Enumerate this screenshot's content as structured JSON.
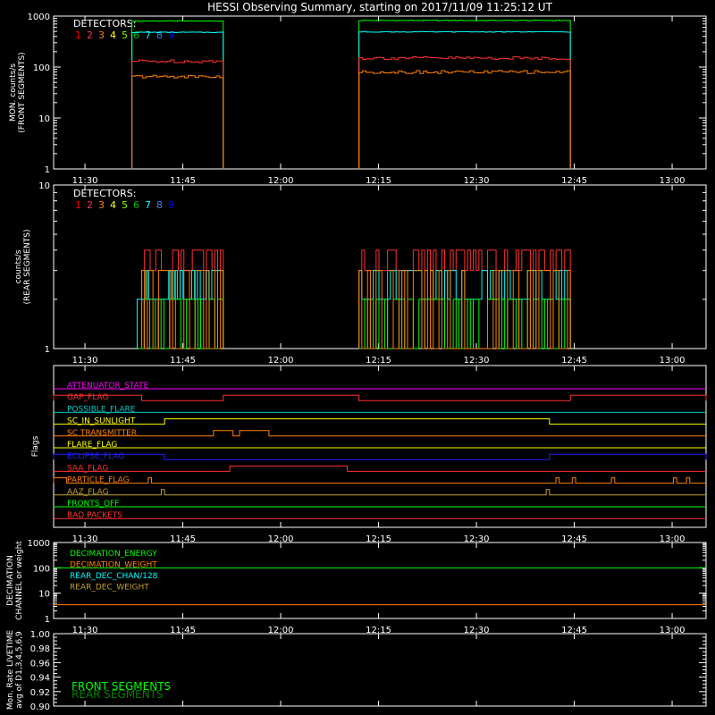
{
  "title": "HESSI Observing Summary, starting on 2017/11/09 11:25:12 UT",
  "time_axis": {
    "start_min": 0,
    "end_min": 100,
    "tick_labels": [
      "11:30",
      "11:45",
      "12:00",
      "12:15",
      "12:30",
      "12:45",
      "13:00"
    ],
    "tick_minutes": [
      4.8,
      19.8,
      34.8,
      49.8,
      64.8,
      79.8,
      94.8
    ]
  },
  "colors": {
    "frame": "#ffffff",
    "det": [
      "#ff3030",
      "#ff3030",
      "#ff8000",
      "#ffff00",
      "#80c000",
      "#00ff00",
      "#00ffff",
      "#0090ff",
      "#0000ff"
    ],
    "det_labels_colors": [
      "#ff0000",
      "#ff3060",
      "#ff8000",
      "#ffff00",
      "#80ff00",
      "#00c000",
      "#00ffff",
      "#4080ff",
      "#0000ff"
    ]
  },
  "chart_data": [
    {
      "id": "front",
      "type": "line",
      "ylabel": "MON. counts/s\n(FRONT SEGMENTS)",
      "yscale": "log",
      "ylim": [
        1,
        1000
      ],
      "ytick_labels": [
        "1",
        "10",
        "100",
        "1000"
      ],
      "legend_title": "DETECTORS:",
      "legend_numbers": [
        "1",
        "2",
        "3",
        "4",
        "5",
        "6",
        "7",
        "8",
        "9"
      ],
      "series": [
        {
          "color": "#00ff00",
          "segments": [
            [
              12.0,
              26.0,
              800
            ],
            [
              46.8,
              79.2,
              820
            ]
          ]
        },
        {
          "color": "#00ffff",
          "segments": [
            [
              12.0,
              26.0,
              480
            ],
            [
              46.8,
              79.2,
              490
            ]
          ]
        },
        {
          "color": "#ff3030",
          "segments": [
            [
              12.0,
              26.0,
              130
            ],
            [
              46.8,
              79.2,
              150
            ]
          ]
        },
        {
          "color": "#ff8000",
          "segments": [
            [
              12.0,
              26.0,
              65
            ],
            [
              46.8,
              79.2,
              80
            ]
          ]
        }
      ]
    },
    {
      "id": "rear",
      "type": "line",
      "ylabel": "counts/s\n(REAR SEGMENTS)",
      "yscale": "log",
      "ylim": [
        1,
        10
      ],
      "ytick_labels": [
        "1",
        "10"
      ],
      "legend_title": "DETECTORS:",
      "legend_numbers": [
        "1",
        "2",
        "3",
        "4",
        "5",
        "6",
        "7",
        "8",
        "9"
      ],
      "series": [
        {
          "color": "#ff3030",
          "levels": [
            3,
            4
          ],
          "segments": [
            [
              13.5,
              26.0
            ],
            [
              46.8,
              79.2
            ]
          ]
        },
        {
          "color": "#00ffff",
          "levels": [
            2,
            3
          ],
          "segments": [
            [
              12.8,
              26.0
            ],
            [
              46.8,
              79.2
            ]
          ]
        },
        {
          "color": "#00ff00",
          "levels": [
            1,
            2
          ],
          "segments": [
            [
              13.0,
              26.0
            ],
            [
              46.8,
              79.2
            ]
          ]
        },
        {
          "color": "#ff8000",
          "levels": [
            1,
            3
          ],
          "segments": [
            [
              13.5,
              26.0
            ],
            [
              46.8,
              79.2
            ]
          ]
        }
      ]
    },
    {
      "id": "flags",
      "type": "table",
      "ylabel": "Flags",
      "flags": [
        {
          "name": "ATTENUATOR_STATE",
          "color": "#ff00ff",
          "on": []
        },
        {
          "name": "GAP_FLAG",
          "color": "#ff3030",
          "on": [
            [
              0,
              13.5
            ],
            [
              26.0,
              46.8
            ],
            [
              79.2,
              100
            ]
          ]
        },
        {
          "name": "POSSIBLE_FLARE",
          "color": "#00c8c8",
          "on": []
        },
        {
          "name": "SC_IN_SUNLIGHT",
          "color": "#ffff00",
          "on": [
            [
              17.0,
              76.0
            ]
          ]
        },
        {
          "name": "SC TRANSMITTER",
          "color": "#ff8000",
          "on": [
            [
              24.5,
              27.5
            ],
            [
              28.5,
              33.0
            ]
          ]
        },
        {
          "name": "FLARE_FLAG",
          "color": "#ffff00",
          "on": []
        },
        {
          "name": "ECLIPSE_FLAG",
          "color": "#2020ff",
          "on": [
            [
              0,
              17.0
            ],
            [
              76.0,
              100
            ]
          ]
        },
        {
          "name": "SAA_FLAG",
          "color": "#ff3030",
          "on": [
            [
              27.0,
              45.0
            ]
          ]
        },
        {
          "name": "PARTICLE_FLAG",
          "color": "#ff8000",
          "on": [
            [
              0,
              2.0
            ],
            [
              14.5,
              15.0
            ],
            [
              77.0,
              77.5
            ],
            [
              79.5,
              80.0
            ],
            [
              85.5,
              86.0
            ],
            [
              95.0,
              95.5
            ],
            [
              97.0,
              97.5
            ]
          ]
        },
        {
          "name": "AAZ_FLAG",
          "color": "#c0a030",
          "on": [
            [
              16.5,
              17.0
            ],
            [
              75.5,
              76.0
            ]
          ]
        },
        {
          "name": "FRONTS_OFF",
          "color": "#00ff00",
          "on": []
        },
        {
          "name": "BAD PACKETS",
          "color": "#ff3030",
          "on": []
        }
      ]
    },
    {
      "id": "decimation",
      "type": "line",
      "ylabel": "DECIMATION\nCHANNEL or weight",
      "yscale": "log",
      "ylim": [
        1,
        1000
      ],
      "ytick_labels": [
        "1",
        "10",
        "100",
        "1000"
      ],
      "labels": [
        {
          "text": "DECIMATION_ENERGY",
          "color": "#00ff00"
        },
        {
          "text": "DECIMATION_WEIGHT",
          "color": "#ff8000"
        },
        {
          "text": "REAR_DEC_CHAN/128",
          "color": "#00ffff"
        },
        {
          "text": "REAR_DEC_WEIGHT",
          "color": "#c0a030"
        }
      ],
      "series": [
        {
          "color": "#00ff00",
          "value": 100
        },
        {
          "color": "#ff8000",
          "value": 3.5
        }
      ]
    },
    {
      "id": "livetime",
      "type": "line",
      "ylabel": "Mon. Rate LIVETIME\navg of D1,3,4,5,6,9",
      "ylim": [
        0.9,
        1.0
      ],
      "ytick_labels": [
        "0.90",
        "0.92",
        "0.94",
        "0.96",
        "0.98",
        "1.00"
      ],
      "legend": [
        {
          "text": "FRONT SEGMENTS",
          "color": "#00ff00"
        },
        {
          "text": "REAR SEGMENTS",
          "color": "#008000"
        }
      ]
    }
  ]
}
